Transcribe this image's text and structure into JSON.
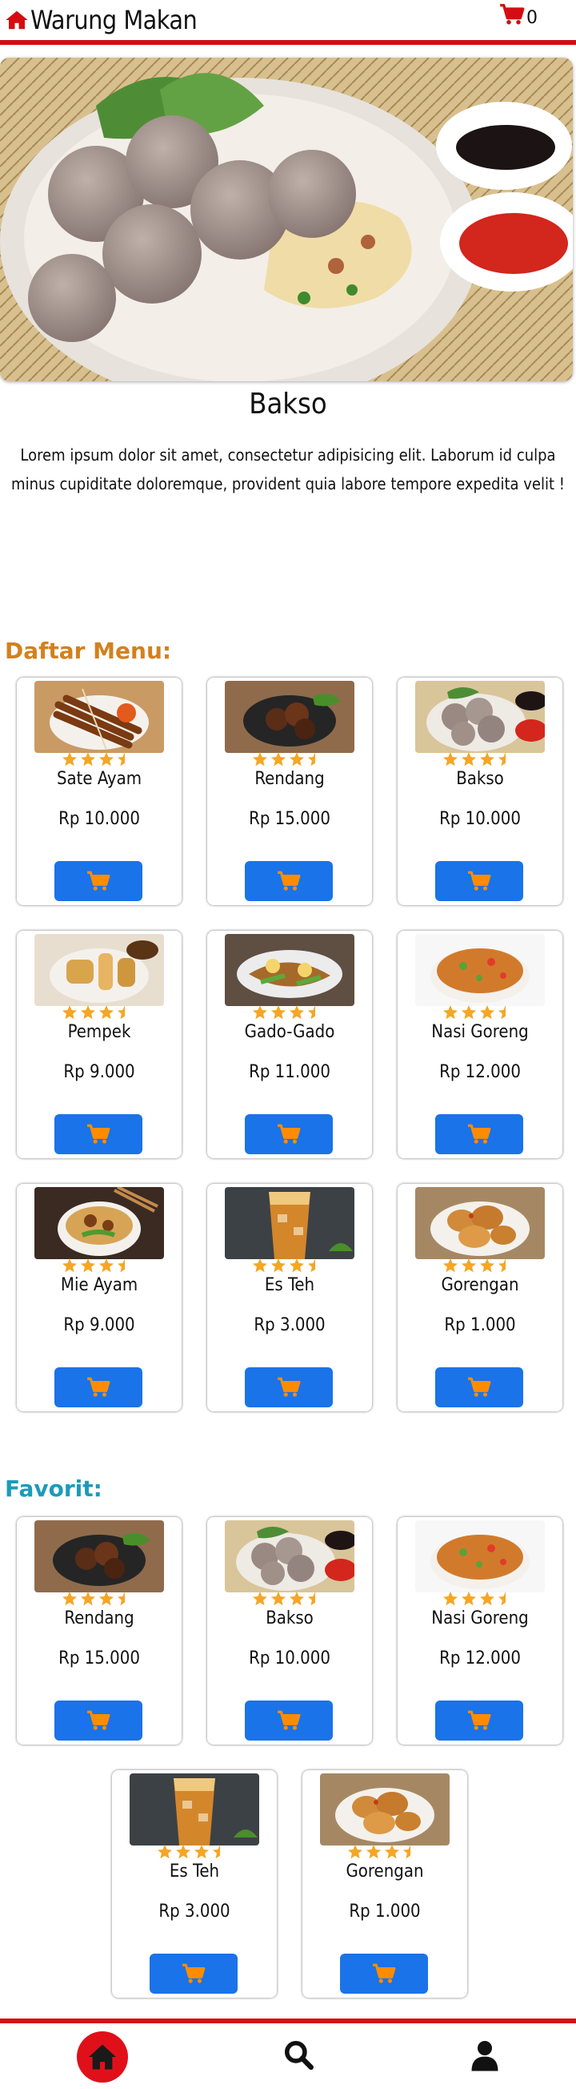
{
  "header": {
    "title": "Warung Makan",
    "home_icon": "home-icon",
    "cart_icon": "shopping-cart-icon",
    "cart_count": "0",
    "accent": "#d40d12"
  },
  "hero": {
    "title": "Bakso",
    "description": "Lorem ipsum dolor sit amet, consectetur adipisicing elit. Laborum id culpa minus cupiditate doloremque, provident quia labore tempore expedita velit !"
  },
  "menu": {
    "heading": "Daftar Menu:",
    "heading_color": "#d2811d",
    "items": [
      {
        "name": "Sate Ayam",
        "price": "Rp 10.000",
        "rating": 3.5
      },
      {
        "name": "Rendang",
        "price": "Rp 15.000",
        "rating": 3.5
      },
      {
        "name": "Bakso",
        "price": "Rp 10.000",
        "rating": 3.5
      },
      {
        "name": "Pempek",
        "price": "Rp 9.000",
        "rating": 3.5
      },
      {
        "name": "Gado-Gado",
        "price": "Rp 11.000",
        "rating": 3.5
      },
      {
        "name": "Nasi Goreng",
        "price": "Rp 12.000",
        "rating": 3.5
      },
      {
        "name": "Mie Ayam",
        "price": "Rp 9.000",
        "rating": 3.5
      },
      {
        "name": "Es Teh",
        "price": "Rp 3.000",
        "rating": 3.5
      },
      {
        "name": "Gorengan",
        "price": "Rp 1.000",
        "rating": 3.5
      }
    ]
  },
  "favorites": {
    "heading": "Favorit:",
    "heading_color": "#1c9bb8",
    "items": [
      {
        "name": "Rendang",
        "price": "Rp 15.000",
        "rating": 3.5
      },
      {
        "name": "Bakso",
        "price": "Rp 10.000",
        "rating": 3.5
      },
      {
        "name": "Nasi Goreng",
        "price": "Rp 12.000",
        "rating": 3.5
      },
      {
        "name": "Es Teh",
        "price": "Rp 3.000",
        "rating": 3.5
      },
      {
        "name": "Gorengan",
        "price": "Rp 1.000",
        "rating": 3.5
      }
    ]
  },
  "bottom_nav": {
    "items": [
      "home-icon",
      "search-icon",
      "user-icon"
    ],
    "active": "home-icon"
  },
  "colors": {
    "button": "#1a73e8",
    "button_icon": "#ff8c00",
    "star": "#f5a623",
    "nav_active": "#e0101a"
  }
}
